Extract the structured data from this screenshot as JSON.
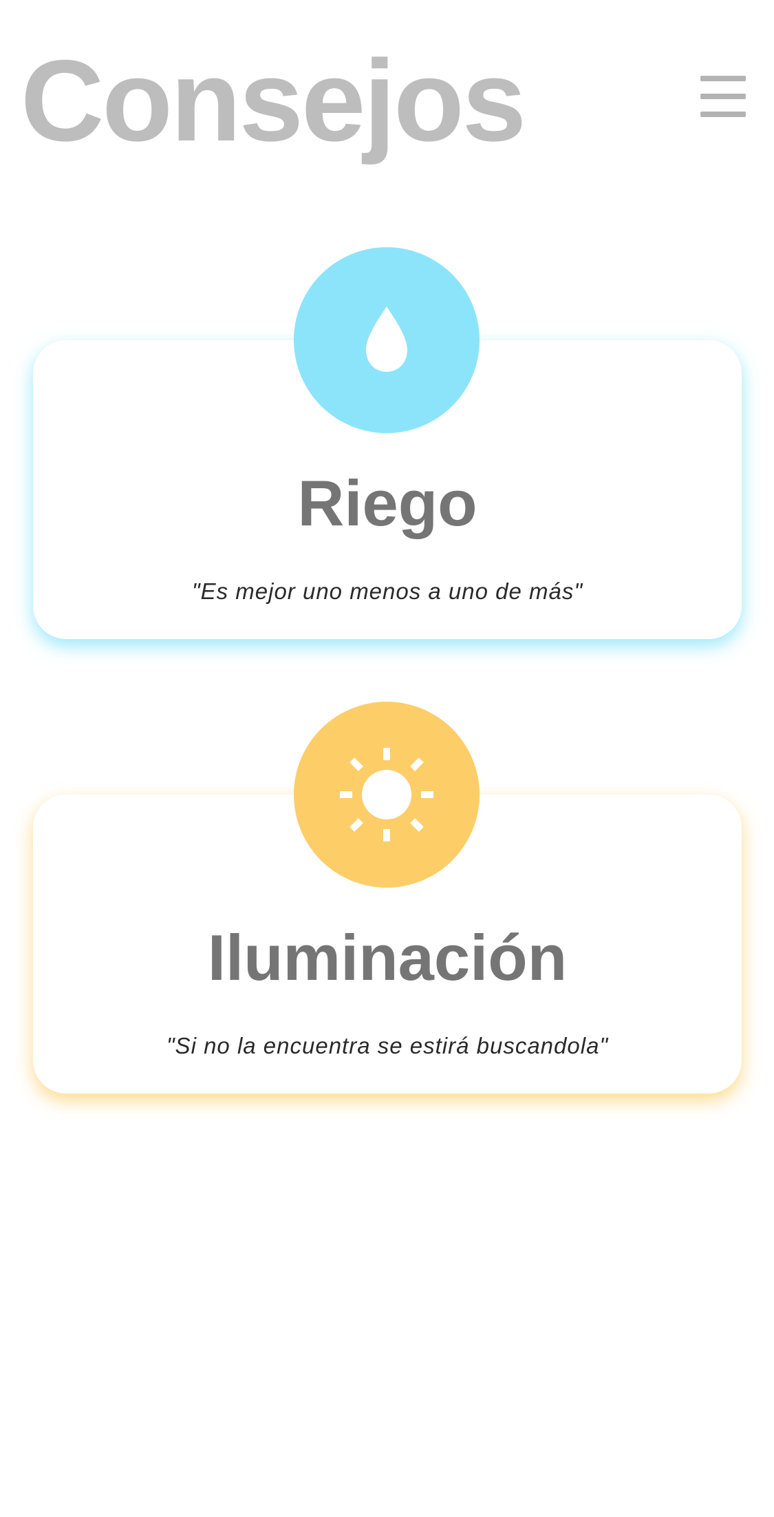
{
  "header": {
    "title": "Consejos",
    "menu_icon": "hamburger-menu-icon"
  },
  "cards": [
    {
      "title": "Riego",
      "quote": "\"Es mejor uno menos a uno de más\"",
      "icon": "water-drop-icon",
      "color": "#8CE4FA"
    },
    {
      "title": "Iluminación",
      "quote": "\"Si no la encuentra se estirá buscandola\"",
      "icon": "sun-icon",
      "color": "#FDCD68"
    }
  ]
}
